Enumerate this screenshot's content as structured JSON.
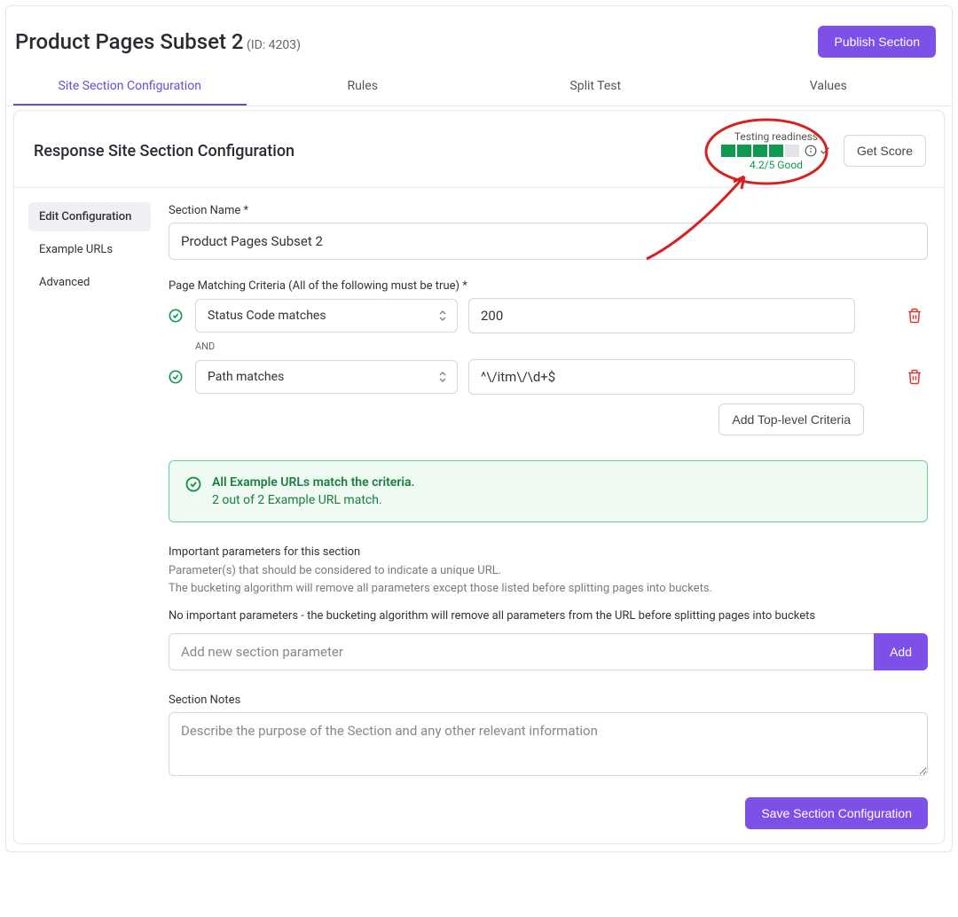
{
  "header": {
    "title": "Product Pages Subset 2",
    "id_label": "(ID: 4203)",
    "publish_label": "Publish Section"
  },
  "tabs": [
    {
      "label": "Site Section Configuration",
      "active": true
    },
    {
      "label": "Rules",
      "active": false
    },
    {
      "label": "Split Test",
      "active": false
    },
    {
      "label": "Values",
      "active": false
    }
  ],
  "card": {
    "title": "Response Site Section Configuration",
    "readiness": {
      "label": "Testing readiness",
      "filled": 4,
      "total": 5,
      "score_text": "4.2/5 Good"
    },
    "get_score_label": "Get Score"
  },
  "sidebar": [
    {
      "label": "Edit Configuration",
      "active": true
    },
    {
      "label": "Example URLs",
      "active": false
    },
    {
      "label": "Advanced",
      "active": false
    }
  ],
  "form": {
    "section_name_label": "Section Name *",
    "section_name_value": "Product Pages Subset 2",
    "criteria_label": "Page Matching Criteria (All of the following must be true) *",
    "criteria": [
      {
        "type": "Status Code matches",
        "value": "200"
      },
      {
        "type": "Path matches",
        "value": "^\\/itm\\/\\d+$"
      }
    ],
    "and_label": "AND",
    "add_criteria_label": "Add Top-level Criteria",
    "banner": {
      "title": "All Example URLs match the criteria.",
      "sub": "2 out of 2 Example URL match."
    },
    "params": {
      "heading": "Important parameters for this section",
      "help1": "Parameter(s) that should be considered to indicate a unique URL.",
      "help2": "The bucketing algorithm will remove all parameters except those listed before splitting pages into buckets.",
      "empty": "No important parameters - the bucketing algorithm will remove all parameters from the URL before splitting pages into buckets",
      "placeholder": "Add new section parameter",
      "add_label": "Add"
    },
    "notes": {
      "label": "Section Notes",
      "placeholder": "Describe the purpose of the Section and any other relevant information"
    },
    "save_label": "Save Section Configuration"
  }
}
